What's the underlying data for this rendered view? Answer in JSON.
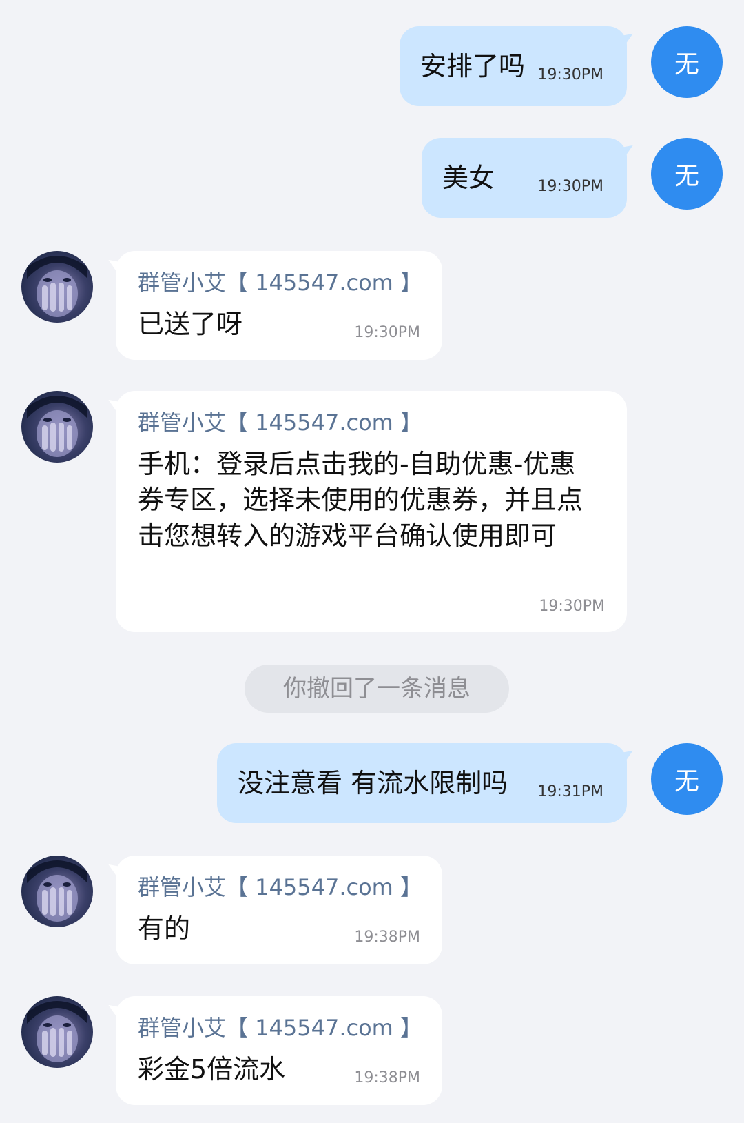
{
  "self_avatar_label": "无",
  "messages": [
    {
      "text": "安排了吗",
      "time": "19:30PM"
    },
    {
      "text": "美女",
      "time": "19:30PM"
    },
    {
      "sender": "群管小艾【 145547.com 】",
      "text": "已送了呀",
      "time": "19:30PM"
    },
    {
      "sender": "群管小艾【 145547.com 】",
      "text": "手机：登录后点击我的-自助优惠-优惠券专区，选择未使用的优惠券，并且点击您想转入的游戏平台确认使用即可",
      "time": "19:30PM"
    },
    {
      "system_text": "你撤回了一条消息"
    },
    {
      "text": "没注意看 有流水限制吗",
      "time": "19:31PM"
    },
    {
      "sender": "群管小艾【 145547.com 】",
      "text": "有的",
      "time": "19:38PM"
    },
    {
      "sender": "群管小艾【 145547.com 】",
      "text": "彩金5倍流水",
      "time": "19:38PM"
    }
  ],
  "colors": {
    "background": "#f2f3f7",
    "outgoing_bubble": "#cce6ff",
    "incoming_bubble": "#ffffff",
    "self_avatar": "#2f8cf0",
    "sender_name": "#5a7394",
    "recall_pill": "#e3e5ea"
  }
}
